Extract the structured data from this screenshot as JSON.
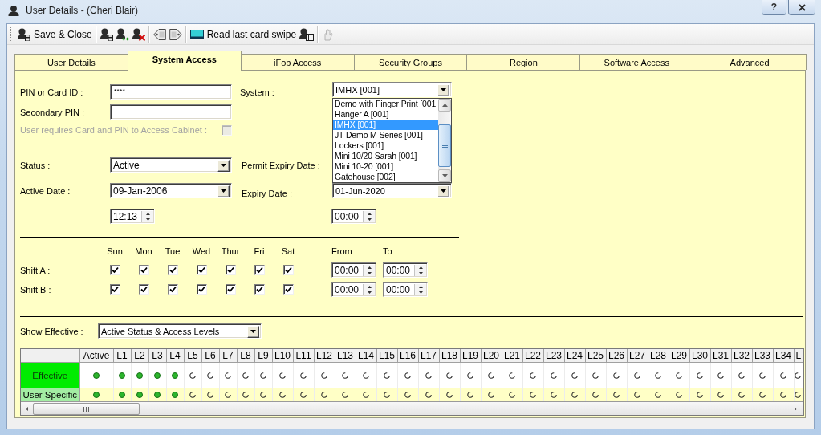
{
  "window": {
    "title": "User Details - (Cheri Blair)",
    "controls": [
      {
        "kind": "help",
        "label": "?"
      },
      {
        "kind": "close"
      }
    ]
  },
  "toolbar": {
    "groups": [
      {
        "items": [
          {
            "kind": "save_close",
            "label": "Save & Close",
            "disabled": false
          }
        ]
      },
      {
        "items": [
          {
            "kind": "save",
            "disabled": false
          },
          {
            "kind": "add",
            "disabled": false
          },
          {
            "kind": "remove",
            "disabled": false
          }
        ]
      },
      {
        "items": [
          {
            "kind": "previous",
            "disabled": false
          },
          {
            "kind": "next",
            "disabled": false
          }
        ]
      },
      {
        "items": [
          {
            "kind": "read_card",
            "label": "Read last card swipe",
            "disabled": false
          },
          {
            "kind": "assign_card",
            "disabled": false
          }
        ]
      },
      {
        "items": [
          {
            "kind": "finger",
            "disabled": true
          }
        ]
      }
    ]
  },
  "tabs": [
    {
      "label": "User Details",
      "selected": false
    },
    {
      "label": "System Access",
      "selected": true
    },
    {
      "label": "iFob Access",
      "selected": false
    },
    {
      "label": "Security Groups",
      "selected": false
    },
    {
      "label": "Region",
      "selected": false
    },
    {
      "label": "Software Access",
      "selected": false
    },
    {
      "label": "Advanced",
      "selected": false
    }
  ],
  "form": {
    "pin": {
      "label": "PIN or Card ID :",
      "value": "****"
    },
    "system": {
      "label": "System :",
      "value": "IMHX [001]",
      "expanded": true,
      "options": [
        {
          "label": "Demo with Finger Print [001",
          "selected": false
        },
        {
          "label": "Hanger A [001]",
          "selected": false
        },
        {
          "label": "IMHX [001]",
          "selected": true
        },
        {
          "label": "JT Demo M Series [001]",
          "selected": false
        },
        {
          "label": "Lockers [001]",
          "selected": false
        },
        {
          "label": "Mini 10/20 Sarah [001]",
          "selected": false
        },
        {
          "label": "Mini 10-20 [001]",
          "selected": false
        },
        {
          "label": "Gatehouse [002]",
          "selected": false
        }
      ]
    },
    "secondary_pin": {
      "label": "Secondary PIN :"
    },
    "card_and_pin": {
      "label": "User requires Card and PIN to Access Cabinet :",
      "checked": false,
      "disabled": true
    },
    "status": {
      "label": "Status :",
      "value": "Active"
    },
    "permit_expiry_date": {
      "label": "Permit Expiry Date :"
    },
    "active_date": {
      "label": "Active Date :",
      "value": "09-Jan-2006",
      "time": "12:13"
    },
    "expiry_date": {
      "label": "Expiry Date :",
      "value": "01-Jun-2020",
      "time": "00:00"
    }
  },
  "shifts": {
    "days": [
      "Sun",
      "Mon",
      "Tue",
      "Wed",
      "Thur",
      "Fri",
      "Sat"
    ],
    "from_label": "From",
    "to_label": "To",
    "rows": [
      {
        "label": "Shift A :",
        "days": [
          {
            "checked": true
          },
          {
            "checked": true
          },
          {
            "checked": true
          },
          {
            "checked": true
          },
          {
            "checked": true
          },
          {
            "checked": true
          },
          {
            "checked": true
          }
        ],
        "from": "00:00",
        "to": "00:00"
      },
      {
        "label": "Shift B :",
        "days": [
          {
            "checked": true
          },
          {
            "checked": true
          },
          {
            "checked": true
          },
          {
            "checked": true
          },
          {
            "checked": true
          },
          {
            "checked": true
          },
          {
            "checked": true
          }
        ],
        "from": "00:00",
        "to": "00:00"
      }
    ]
  },
  "show_effective": {
    "label": "Show Effective :",
    "value": "Active Status & Access Levels"
  },
  "access_grid": {
    "columns": [
      "Active",
      "L1",
      "L2",
      "L3",
      "L4",
      "L5",
      "L6",
      "L7",
      "L8",
      "L9",
      "L10",
      "L11",
      "L12",
      "L13",
      "L14",
      "L15",
      "L16",
      "L17",
      "L18",
      "L19",
      "L20",
      "L21",
      "L22",
      "L23",
      "L24",
      "L25",
      "L26",
      "L27",
      "L28",
      "L29",
      "L30",
      "L31",
      "L32",
      "L33",
      "L34",
      "L"
    ],
    "rows": [
      {
        "label": "Effective",
        "kind": "effective",
        "cells": [
          {
            "on": true
          },
          {
            "on": true
          },
          {
            "on": true
          },
          {
            "on": true
          },
          {
            "on": true
          },
          {
            "on": false
          },
          {
            "on": false
          },
          {
            "on": false
          },
          {
            "on": false
          },
          {
            "on": false
          },
          {
            "on": false
          },
          {
            "on": false
          },
          {
            "on": false
          },
          {
            "on": false
          },
          {
            "on": false
          },
          {
            "on": false
          },
          {
            "on": false
          },
          {
            "on": false
          },
          {
            "on": false
          },
          {
            "on": false
          },
          {
            "on": false
          },
          {
            "on": false
          },
          {
            "on": false
          },
          {
            "on": false
          },
          {
            "on": false
          },
          {
            "on": false
          },
          {
            "on": false
          },
          {
            "on": false
          },
          {
            "on": false
          },
          {
            "on": false
          },
          {
            "on": false
          },
          {
            "on": false
          },
          {
            "on": false
          },
          {
            "on": false
          },
          {
            "on": false
          },
          {
            "on": false
          }
        ]
      },
      {
        "label": "User Specific",
        "kind": "user_specific",
        "cells": [
          {
            "on": true
          },
          {
            "on": true
          },
          {
            "on": true
          },
          {
            "on": true
          },
          {
            "on": true
          },
          {
            "on": false
          },
          {
            "on": false
          },
          {
            "on": false
          },
          {
            "on": false
          },
          {
            "on": false
          },
          {
            "on": false
          },
          {
            "on": false
          },
          {
            "on": false
          },
          {
            "on": false
          },
          {
            "on": false
          },
          {
            "on": false
          },
          {
            "on": false
          },
          {
            "on": false
          },
          {
            "on": false
          },
          {
            "on": false
          },
          {
            "on": false
          },
          {
            "on": false
          },
          {
            "on": false
          },
          {
            "on": false
          },
          {
            "on": false
          },
          {
            "on": false
          },
          {
            "on": false
          },
          {
            "on": false
          },
          {
            "on": false
          },
          {
            "on": false
          },
          {
            "on": false
          },
          {
            "on": false
          },
          {
            "on": false
          },
          {
            "on": false
          },
          {
            "on": false
          },
          {
            "on": false
          }
        ]
      }
    ]
  }
}
